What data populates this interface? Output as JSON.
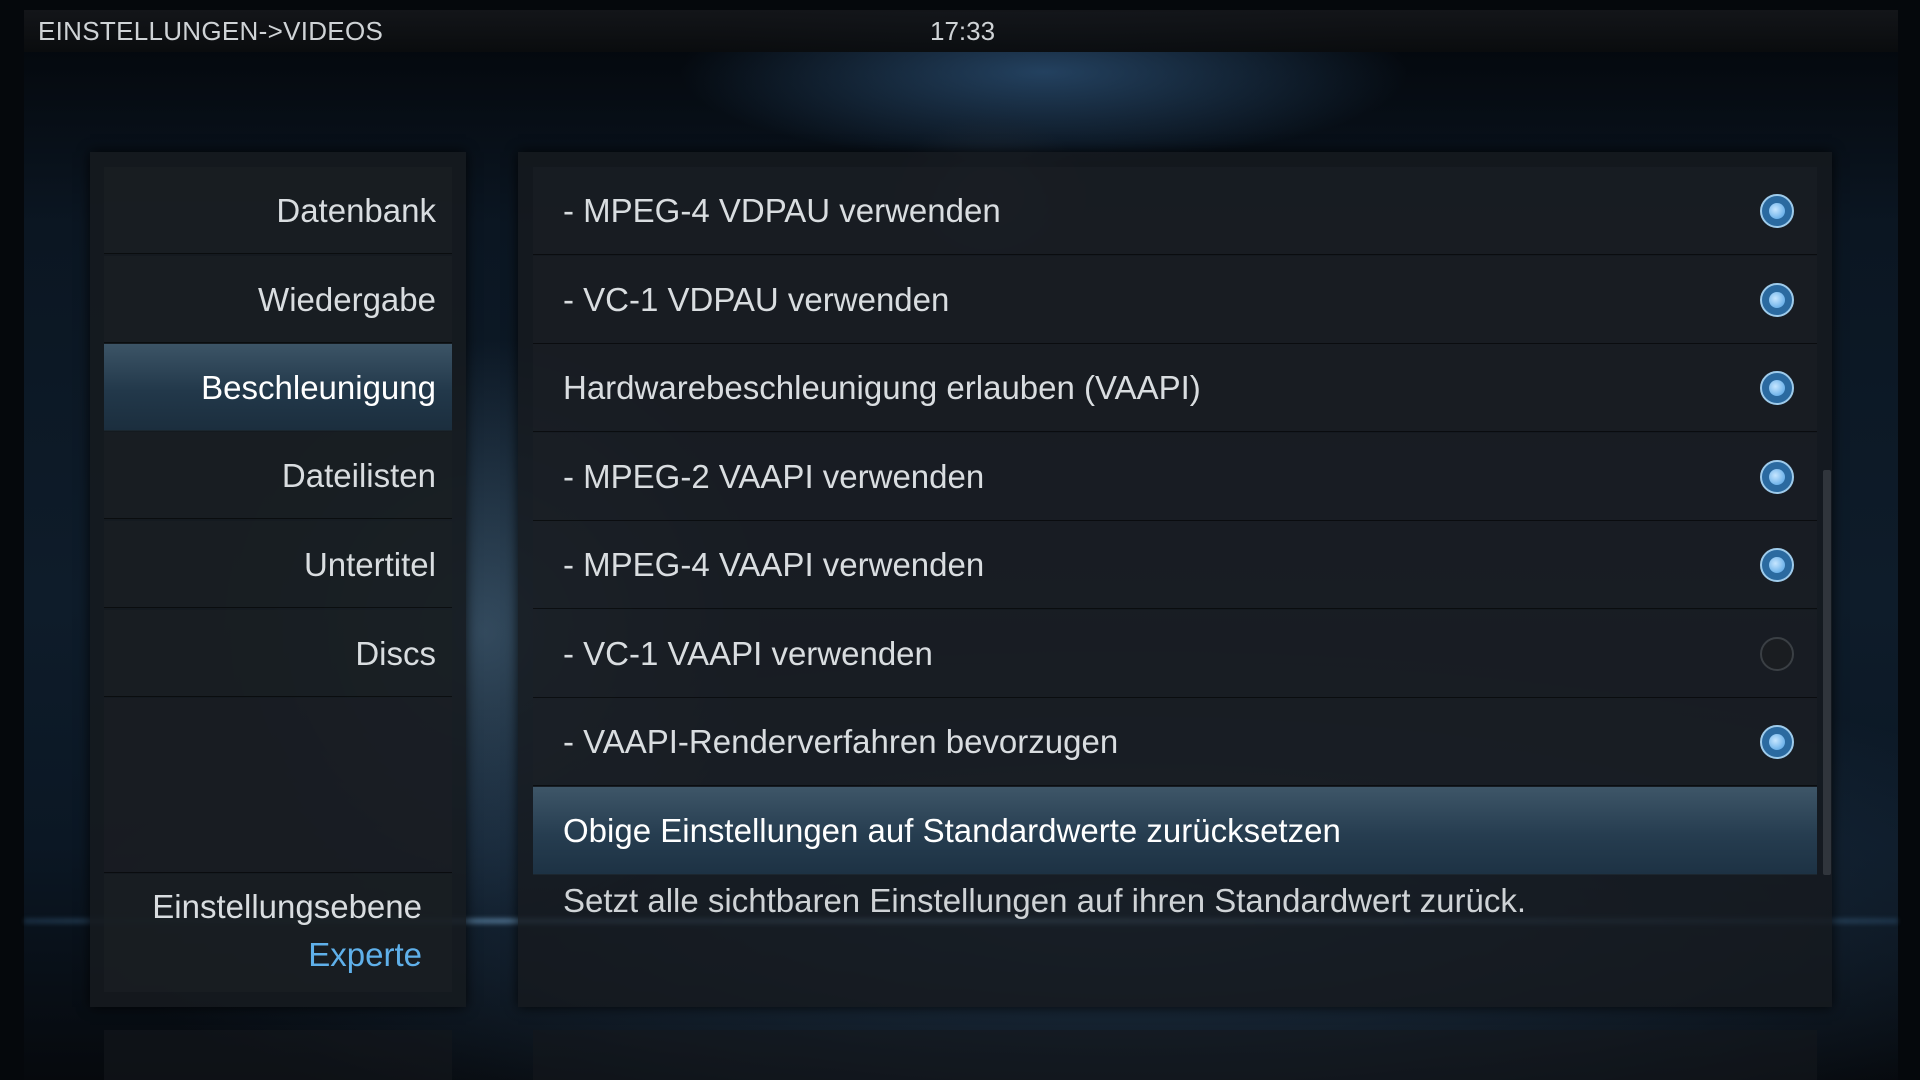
{
  "header": {
    "breadcrumb": "EINSTELLUNGEN->VIDEOS",
    "clock": "17:33"
  },
  "sidebar": {
    "items": [
      {
        "label": "Datenbank",
        "active": false
      },
      {
        "label": "Wiedergabe",
        "active": false
      },
      {
        "label": "Beschleunigung",
        "active": true
      },
      {
        "label": "Dateilisten",
        "active": false
      },
      {
        "label": "Untertitel",
        "active": false
      },
      {
        "label": "Discs",
        "active": false
      }
    ],
    "settings_level": {
      "label": "Einstellungsebene",
      "value": "Experte"
    }
  },
  "settings": {
    "rows": [
      {
        "label": "- MPEG-4 VDPAU verwenden",
        "enabled": true
      },
      {
        "label": "- VC-1 VDPAU verwenden",
        "enabled": true
      },
      {
        "label": "Hardwarebeschleunigung erlauben (VAAPI)",
        "enabled": true
      },
      {
        "label": "- MPEG-2 VAAPI verwenden",
        "enabled": true
      },
      {
        "label": "- MPEG-4 VAAPI verwenden",
        "enabled": true
      },
      {
        "label": "- VC-1 VAAPI verwenden",
        "enabled": false
      },
      {
        "label": "- VAAPI-Renderverfahren bevorzugen",
        "enabled": true
      }
    ],
    "reset_button": {
      "label": "Obige Einstellungen auf Standardwerte zurücksetzen"
    },
    "description": "Setzt alle sichtbaren Einstellungen auf ihren Standardwert zurück."
  },
  "colors": {
    "accent": "#5fb0ea",
    "focus_bg": "#2b4557",
    "radio_on": "#6fb3ea"
  },
  "icons": {
    "radio_on": "radio-on-icon",
    "radio_off": "radio-off-icon"
  }
}
